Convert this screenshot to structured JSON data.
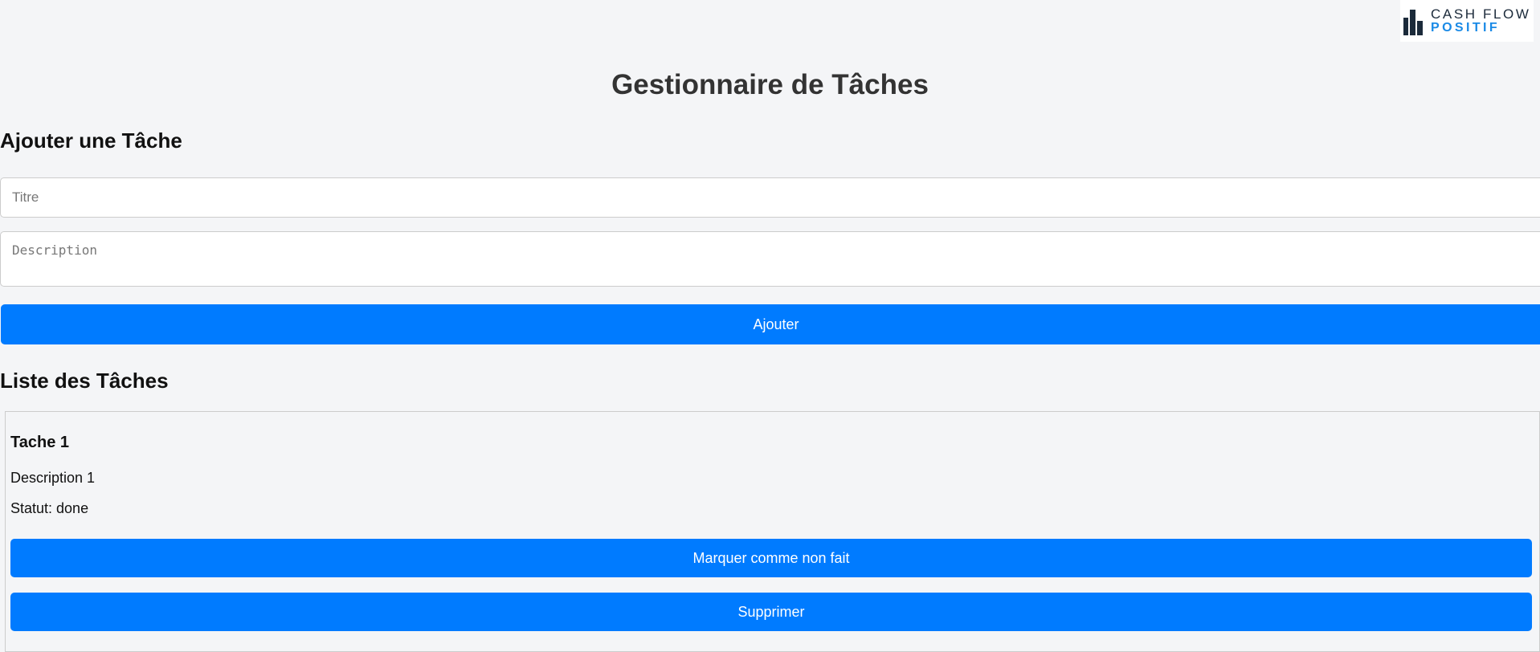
{
  "logo": {
    "line1": "CASH FLOW",
    "line2": "POSITIF",
    "colors": {
      "dark": "#1b2a3a",
      "accent": "#1a8ae6"
    }
  },
  "page": {
    "title": "Gestionnaire de Tâches"
  },
  "add_form": {
    "heading": "Ajouter une Tâche",
    "title_placeholder": "Titre",
    "title_value": "",
    "description_placeholder": "Description",
    "description_value": "",
    "submit_label": "Ajouter"
  },
  "task_list": {
    "heading": "Liste des Tâches",
    "tasks": [
      {
        "title": "Tache 1",
        "description": "Description 1",
        "status_text": "Statut: done",
        "toggle_label": "Marquer comme non fait",
        "delete_label": "Supprimer"
      }
    ]
  },
  "colors": {
    "primary": "#007bff",
    "background": "#f4f5f7"
  }
}
